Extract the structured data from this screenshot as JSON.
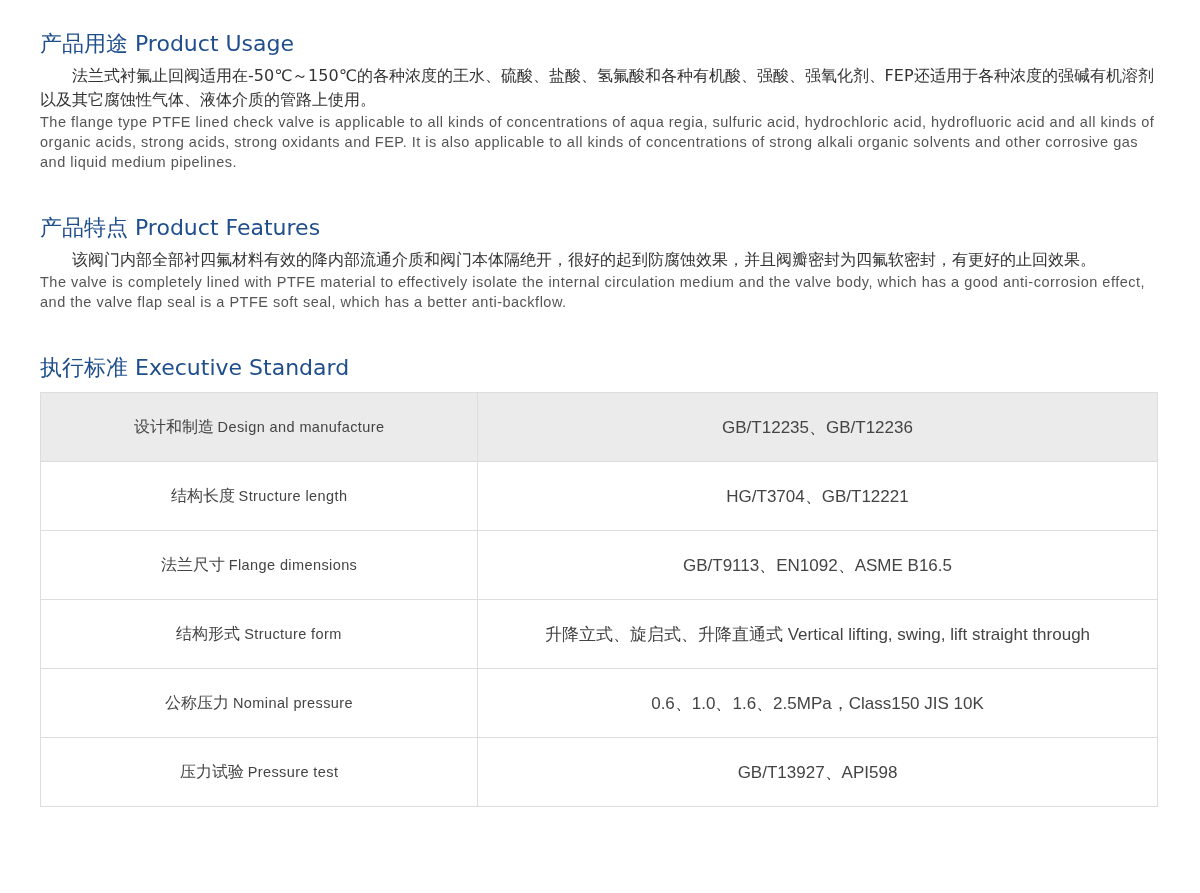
{
  "sections": [
    {
      "heading_zh": "产品用途",
      "heading_en": "Product Usage",
      "text_zh": "法兰式衬氟止回阀适用在-50℃～150℃的各种浓度的王水、硫酸、盐酸、氢氟酸和各种有机酸、强酸、强氧化剂、FEP还适用于各种浓度的强碱有机溶剂以及其它腐蚀性气体、液体介质的管路上使用。",
      "text_en": "The flange type PTFE lined check valve is applicable to all kinds of concentrations of aqua regia, sulfuric acid, hydrochloric acid, hydrofluoric acid and all kinds of organic acids, strong acids, strong oxidants and FEP. It is also applicable to all kinds of concentrations of strong alkali organic solvents and other corrosive gas and liquid medium pipelines."
    },
    {
      "heading_zh": "产品特点",
      "heading_en": "Product Features",
      "text_zh": "该阀门内部全部衬四氟材料有效的降内部流通介质和阀门本体隔绝开，很好的起到防腐蚀效果，并且阀瓣密封为四氟软密封，有更好的止回效果。",
      "text_en": "The valve is completely lined with PTFE material to effectively isolate the internal circulation medium and the valve body, which has a good anti-corrosion effect, and the valve flap seal is a PTFE soft seal, which has a better anti-backflow."
    }
  ],
  "standard": {
    "heading_zh": "执行标准",
    "heading_en": "Executive Standard",
    "rows": [
      {
        "item_zh": "设计和制造",
        "item_en": "Design and manufacture",
        "value": "GB/T12235、GB/T12236"
      },
      {
        "item_zh": "结构长度",
        "item_en": "Structure length",
        "value": "HG/T3704、GB/T12221"
      },
      {
        "item_zh": "法兰尺寸",
        "item_en": "Flange dimensions",
        "value": "GB/T9113、EN1092、ASME B16.5"
      },
      {
        "item_zh": "结构形式",
        "item_en": "Structure form",
        "value": "升降立式、旋启式、升降直通式 Vertical lifting, swing, lift straight through"
      },
      {
        "item_zh": "公称压力",
        "item_en": "Nominal pressure",
        "value": "0.6、1.0、1.6、2.5MPa，Class150 JIS 10K"
      },
      {
        "item_zh": "压力试验",
        "item_en": "Pressure test",
        "value": "GB/T13927、API598"
      }
    ]
  }
}
